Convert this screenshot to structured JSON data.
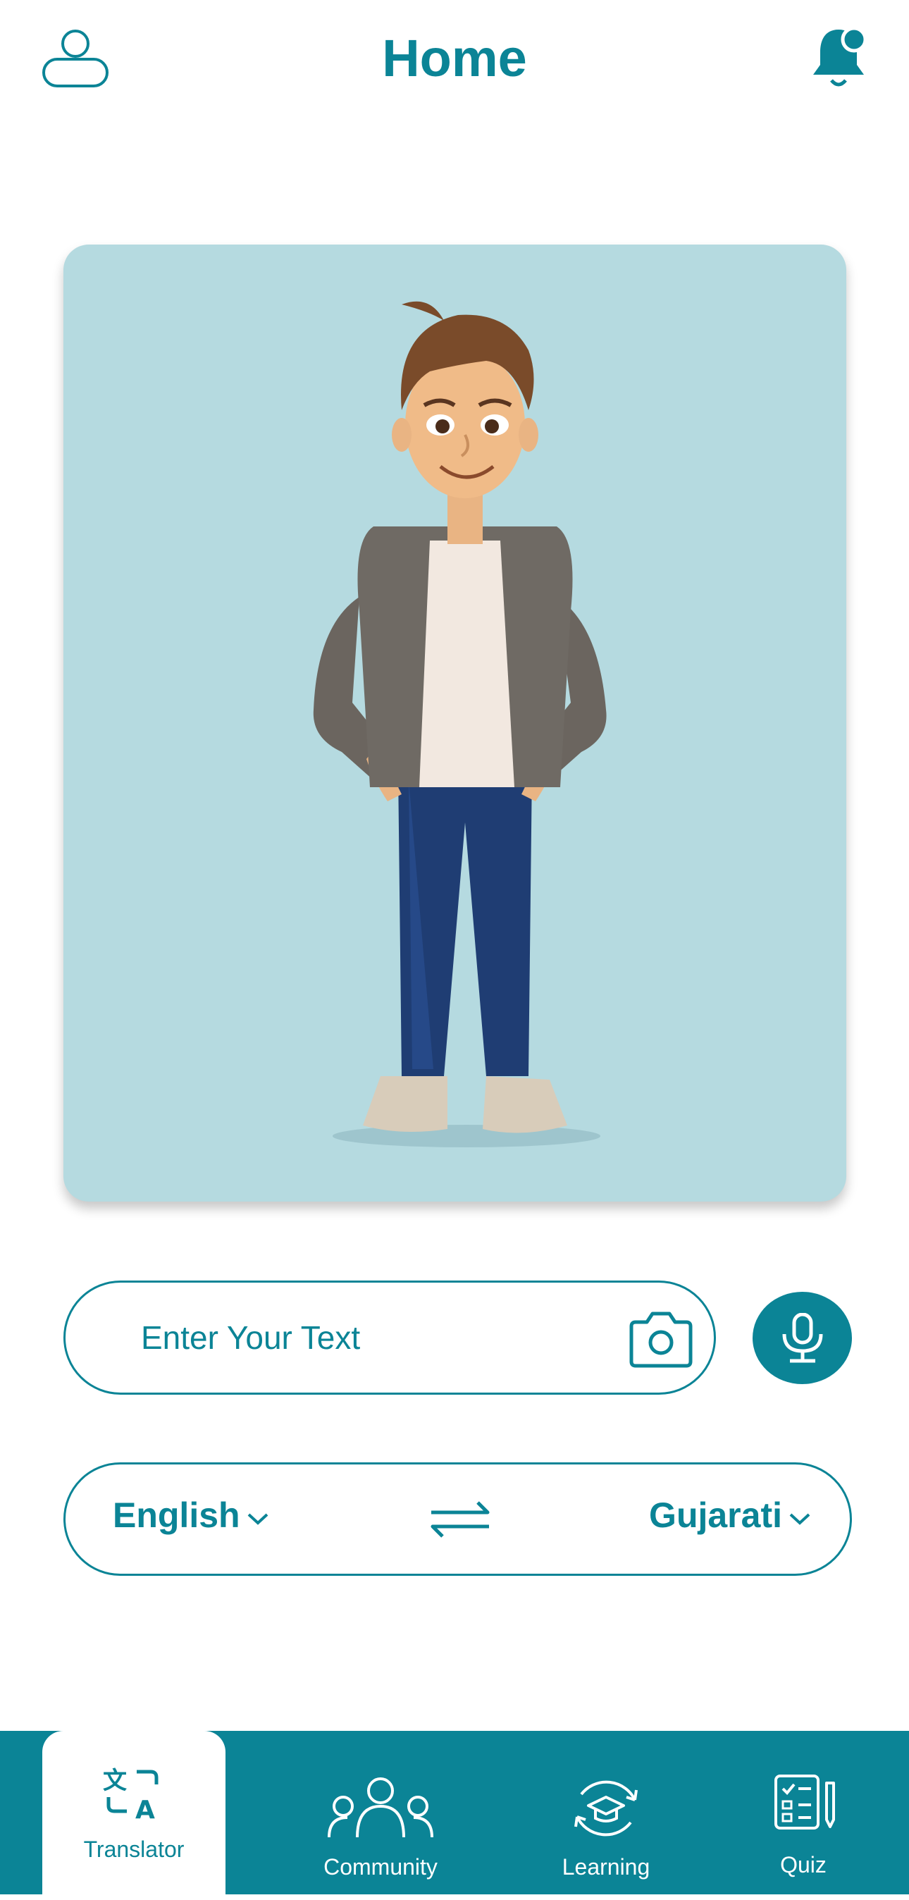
{
  "header": {
    "title": "Home",
    "profile_icon": "profile-icon",
    "notification_icon": "bell-icon"
  },
  "avatar": {
    "description_icon": "avatar-illustration"
  },
  "input": {
    "placeholder": "Enter Your Text",
    "value": "",
    "camera_icon": "camera-icon",
    "mic_icon": "microphone-icon"
  },
  "languages": {
    "source": "English",
    "target": "Gujarati",
    "swap_icon": "swap-icon"
  },
  "nav": {
    "items": [
      {
        "label": "Translator",
        "icon": "translate-icon",
        "active": true
      },
      {
        "label": "Community",
        "icon": "community-icon",
        "active": false
      },
      {
        "label": "Learning",
        "icon": "learning-icon",
        "active": false
      },
      {
        "label": "Quiz",
        "icon": "quiz-icon",
        "active": false
      }
    ]
  },
  "colors": {
    "accent": "#0b8496",
    "card_bg": "#b5dae0",
    "background": "#ffffff"
  }
}
